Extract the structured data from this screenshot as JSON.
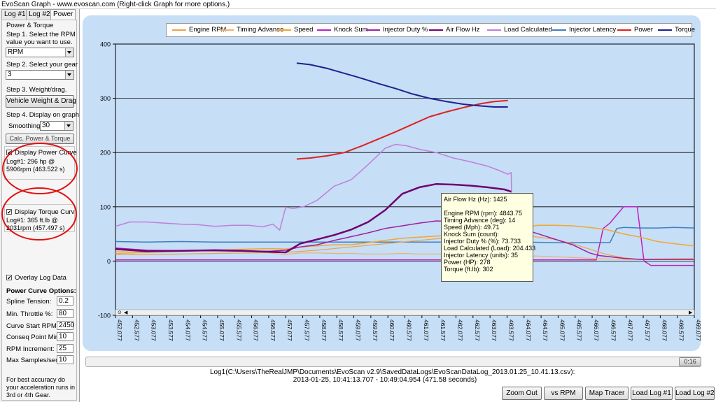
{
  "window": {
    "title": "EvoScan Graph - www.evoscan.com  (Right-click Graph for more options.)"
  },
  "tabs": [
    "Log #1",
    "Log #2",
    "Power"
  ],
  "panel": {
    "group_title": "Power & Torque",
    "step1": [
      "Step 1. Select the RPM",
      "value you want to use."
    ],
    "rpm_select": "RPM",
    "step2": "Step 2. Select your gear",
    "gear_select": "3",
    "step3": "Step 3. Weight/drag.",
    "weight_button": "Vehicle Weight & Drag",
    "step4": "Step 4. Display on graph",
    "smoothing_label": "Smoothing:",
    "smoothing_value": "30",
    "calc_button": "Calc. Power & Torque",
    "power_curve": {
      "label": "Display Power Curve",
      "checked": "✔",
      "info": [
        "Log#1: 296 hp @",
        "5906rpm (463.522 s)"
      ]
    },
    "torque_curve": {
      "label": "Display Torque Curv",
      "checked": "✔",
      "info": [
        "Log#1: 365 ft.lb @",
        "2031rpm (457.497 s)"
      ]
    },
    "overlay": {
      "label": "Overlay Log Data",
      "checked": "✔"
    },
    "options_title": "Power Curve Options:",
    "options": [
      {
        "label": "Spline Tension:",
        "value": "0.2"
      },
      {
        "label": "Min. Throttle %:",
        "value": "80"
      },
      {
        "label": "Curve Start RPM:",
        "value": "2450"
      },
      {
        "label": "Conseq Point Min.",
        "value": "10"
      },
      {
        "label": "RPM Increment:",
        "value": "25"
      },
      {
        "label": "Max Samples/sec:",
        "value": "10"
      }
    ],
    "tip": [
      "For best accuracy do",
      "your acceleration runs in",
      "3rd or 4th Gear."
    ]
  },
  "legend": [
    {
      "name": "Engine RPM",
      "color": "#f0a050"
    },
    {
      "name": "Timing Advance",
      "color": "#f0b070"
    },
    {
      "name": "Speed",
      "color": "#f0a830"
    },
    {
      "name": "Knock Sum",
      "color": "#c020c0"
    },
    {
      "name": "Injector Duty %",
      "color": "#a020a0"
    },
    {
      "name": "Air Flow Hz",
      "color": "#700070"
    },
    {
      "name": "Load Calculated",
      "color": "#c080d8"
    },
    {
      "name": "Injector Latency",
      "color": "#4080c0"
    },
    {
      "name": "Power",
      "color": "#e02020"
    },
    {
      "name": "Torque",
      "color": "#202090"
    }
  ],
  "chart_data": {
    "type": "line",
    "ylim": [
      -100,
      400
    ],
    "yticks": [
      "400",
      "300",
      "200",
      "100",
      "0",
      "-100"
    ],
    "xlim": [
      452.077,
      469.077
    ],
    "xticks": [
      "452.077",
      "452.577",
      "453.077",
      "453.577",
      "454.077",
      "454.577",
      "455.077",
      "455.577",
      "456.077",
      "456.577",
      "457.077",
      "457.577",
      "458.077",
      "458.577",
      "459.077",
      "459.577",
      "460.077",
      "460.577",
      "461.077",
      "461.577",
      "462.077",
      "462.577",
      "463.077",
      "463.577",
      "464.077",
      "464.577",
      "465.077",
      "465.577",
      "466.077",
      "466.577",
      "467.077",
      "467.577",
      "468.077",
      "468.577",
      "469.077"
    ],
    "series": [
      {
        "name": "Torque",
        "color": "#202090",
        "width": 2,
        "x": [
          457.4,
          457.8,
          458.3,
          458.8,
          459.3,
          459.8,
          460.3,
          460.8,
          461.3,
          461.8,
          462.3,
          462.8,
          463.2,
          463.6
        ],
        "y": [
          365,
          362,
          355,
          346,
          337,
          327,
          318,
          308,
          300,
          294,
          289,
          286,
          284,
          284
        ]
      },
      {
        "name": "Power",
        "color": "#e02020",
        "width": 2,
        "x": [
          457.4,
          457.8,
          458.3,
          458.8,
          459.3,
          459.8,
          460.3,
          460.8,
          461.3,
          461.8,
          462.3,
          462.8,
          463.2,
          463.6
        ],
        "y": [
          188,
          190,
          194,
          200,
          212,
          225,
          238,
          252,
          266,
          275,
          283,
          290,
          294,
          296
        ]
      },
      {
        "name": "Air Flow Hz",
        "color": "#700070",
        "width": 2.5,
        "x": [
          452.077,
          453.0,
          454.0,
          455.0,
          455.8,
          456.6,
          457.077,
          457.5,
          458.0,
          458.5,
          459.0,
          459.5,
          460.0,
          460.5,
          461.0,
          461.5,
          462.0,
          462.5,
          463.0,
          463.5,
          463.7
        ],
        "y": [
          22,
          18,
          19,
          20,
          19,
          17,
          16,
          32,
          40,
          48,
          58,
          72,
          94,
          124,
          136,
          142,
          141,
          139,
          136,
          132,
          128
        ]
      },
      {
        "name": "Load Calculated",
        "color": "#c080d8",
        "width": 1.5,
        "x": [
          452.077,
          452.5,
          453.0,
          453.5,
          454.0,
          454.5,
          455.0,
          455.5,
          456.0,
          456.4,
          456.7,
          456.9,
          457.077,
          457.3,
          457.6,
          458.0,
          458.5,
          459.0,
          459.5,
          460.0,
          460.3,
          460.6,
          461.0,
          461.5,
          462.0,
          462.5,
          463.0,
          463.3,
          463.6,
          463.7,
          463.75
        ],
        "y": [
          64,
          72,
          72,
          70,
          68,
          67,
          64,
          66,
          66,
          63,
          68,
          57,
          99,
          97,
          100,
          112,
          138,
          150,
          178,
          208,
          215,
          213,
          206,
          200,
          190,
          183,
          175,
          168,
          160,
          163,
          4
        ]
      },
      {
        "name": "Injector Duty %",
        "color": "#a020a0",
        "width": 1.5,
        "x": [
          452.077,
          453.0,
          454.0,
          455.0,
          456.0,
          456.6,
          457.077,
          457.5,
          458.0,
          458.5,
          459.0,
          459.5,
          460.0,
          460.5,
          461.0,
          461.5,
          462.0,
          462.5,
          463.0,
          463.5,
          463.7,
          464.0,
          465.0,
          465.5,
          466.0,
          466.3,
          466.6,
          467.0,
          467.5,
          468.0,
          469.077
        ],
        "y": [
          24,
          20,
          19,
          19,
          18,
          18,
          20,
          26,
          30,
          38,
          45,
          52,
          60,
          65,
          70,
          74,
          73,
          72,
          71,
          71,
          70,
          60,
          40,
          30,
          15,
          10,
          8,
          5,
          3,
          3,
          3
        ]
      },
      {
        "name": "Engine RPM",
        "color": "#f0a050",
        "width": 1.2,
        "x": [
          452.077,
          453.0,
          454.0,
          455.0,
          456.0,
          457.077,
          458.0,
          459.0,
          460.0,
          461.0,
          462.0,
          463.0,
          463.7,
          464.0,
          465.0,
          465.5,
          466.0,
          466.5,
          467.0,
          467.5,
          468.0,
          469.077
        ],
        "y": [
          12,
          12,
          13,
          14,
          15,
          16,
          20,
          26,
          32,
          38,
          44,
          48,
          50,
          48,
          40,
          32,
          22,
          12,
          6,
          3,
          3,
          3
        ]
      },
      {
        "name": "Speed",
        "color": "#f0a830",
        "width": 1.5,
        "x": [
          452.077,
          453.0,
          454.0,
          455.0,
          456.0,
          456.6,
          457.077,
          457.5,
          458.0,
          458.5,
          459.0,
          459.5,
          460.0,
          460.5,
          461.0,
          461.5,
          462.0,
          462.5,
          463.0,
          463.7,
          464.0,
          464.5,
          465.0,
          465.5,
          466.0,
          466.5,
          467.0,
          467.5,
          468.0,
          468.5,
          469.077
        ],
        "y": [
          14,
          16,
          18,
          20,
          22,
          23,
          22,
          26,
          28,
          30,
          30,
          34,
          38,
          42,
          44,
          46,
          48,
          50,
          51,
          50,
          62,
          66,
          66,
          65,
          62,
          58,
          50,
          44,
          36,
          32,
          28
        ]
      },
      {
        "name": "Timing Advance",
        "color": "#f0b070",
        "width": 1.2,
        "x": [
          452.077,
          453.0,
          454.0,
          455.0,
          456.0,
          456.6,
          457.077,
          457.5,
          458.0,
          458.5,
          459.0,
          459.5,
          460.0,
          460.5,
          461.0,
          461.5,
          462.0,
          462.5,
          463.0,
          463.7,
          464.0,
          465.0,
          466.0,
          467.0,
          468.0,
          469.077
        ],
        "y": [
          18,
          17,
          18,
          19,
          18,
          15,
          12,
          15,
          15,
          14,
          14,
          13,
          13,
          14,
          13,
          13,
          14,
          14,
          14,
          14,
          10,
          8,
          5,
          3,
          4,
          5
        ]
      },
      {
        "name": "Knock Sum",
        "color": "#c020c0",
        "width": 1.5,
        "x": [
          452.077,
          455.0,
          457.077,
          460.0,
          463.7,
          465.0,
          466.2,
          466.4,
          466.6,
          466.8,
          467.0,
          467.2,
          467.4,
          467.6,
          467.8,
          468.0,
          469.077
        ],
        "y": [
          2,
          2,
          2,
          2,
          2,
          2,
          2,
          60,
          70,
          85,
          100,
          100,
          100,
          0,
          -8,
          -8,
          -8
        ]
      },
      {
        "name": "Injector Latency",
        "color": "#4080c0",
        "width": 1.5,
        "x": [
          452.077,
          453.0,
          454.0,
          455.0,
          456.0,
          457.077,
          458.0,
          459.0,
          460.0,
          461.0,
          462.0,
          463.0,
          464.0,
          465.0,
          466.0,
          466.6,
          466.8,
          467.0,
          467.5,
          468.0,
          468.5,
          469.077
        ],
        "y": [
          36,
          35,
          36,
          35,
          35,
          35,
          35,
          35,
          35,
          35,
          35,
          35,
          35,
          34,
          34,
          34,
          60,
          62,
          61,
          61,
          62,
          61
        ]
      }
    ]
  },
  "tooltip": [
    "Air Flow Hz (Hz): 1425",
    "",
    "Engine RPM (rpm): 4843.75",
    "Timing Advance (deg): 14",
    "Speed (Mph): 49.71",
    "Knock Sum (count):",
    "Injector Duty % (%): 73.733",
    "Load Calculated (Load): 204.433",
    "Injector Latency (units): 35",
    "Power (HP): 278",
    "Torque (ft.lb): 302"
  ],
  "scroll_thumb": "0:16",
  "status": {
    "line1": "Log1(C:\\Users\\TheRealJMP\\Documents\\EvoScan v2.9\\SavedDataLogs\\EvoScanDataLog_2013.01.25_10.41.13.csv):",
    "line2": "2013-01-25,  10:41:13.707 - 10:49:04.954  (471.58 seconds)"
  },
  "buttons": [
    "Zoom Out",
    "vs RPM",
    "Map Tracer",
    "Load Log #1",
    "Load Log #2"
  ]
}
